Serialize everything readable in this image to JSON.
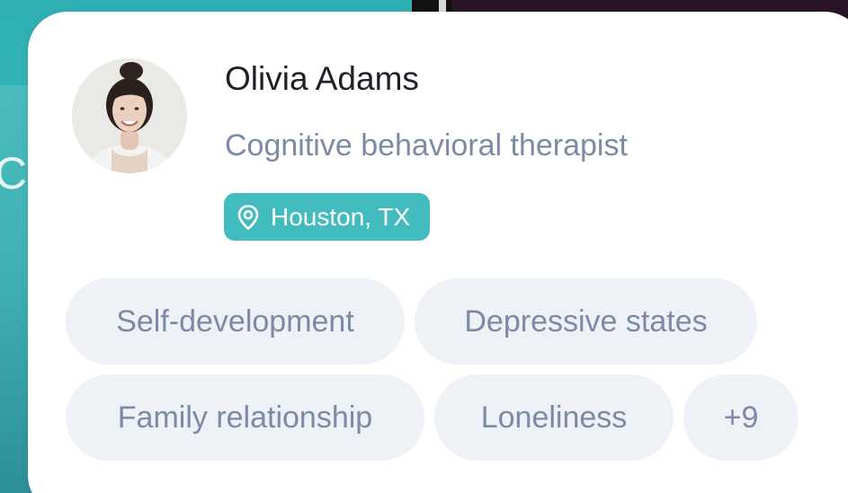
{
  "profile": {
    "name": "Olivia Adams",
    "role": "Cognitive behavioral therapist",
    "location": "Houston, TX",
    "location_icon": "map-pin-icon",
    "avatar_alt": "Olivia Adams avatar"
  },
  "tags": {
    "row1": [
      "Self-development",
      "Depressive states"
    ],
    "row2": [
      "Family relationship",
      "Loneliness"
    ],
    "more": "+9"
  },
  "colors": {
    "accent": "#43bcbf",
    "tag_bg": "#eef1f5",
    "muted_text": "#7d8aa6",
    "name_text": "#1f2126"
  }
}
